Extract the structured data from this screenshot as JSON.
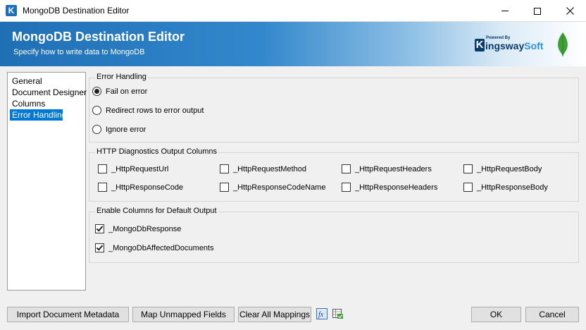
{
  "window": {
    "title": "MongoDB Destination Editor"
  },
  "banner": {
    "title": "MongoDB Destination Editor",
    "subtitle": "Specify how to write data to MongoDB",
    "logo_powered": "Powered By",
    "logo_letter": "K",
    "logo_name_a": "ingsway",
    "logo_name_b": "Soft"
  },
  "nav": {
    "items": [
      {
        "label": "General"
      },
      {
        "label": "Document Designer"
      },
      {
        "label": "Columns"
      },
      {
        "label": "Error Handling"
      }
    ],
    "selected": "Error Handling"
  },
  "error_handling": {
    "group_label": "Error Handling",
    "options": [
      {
        "label": "Fail on error",
        "selected": true
      },
      {
        "label": "Redirect rows to error output",
        "selected": false
      },
      {
        "label": "Ignore error",
        "selected": false
      }
    ]
  },
  "http_diagnostics": {
    "group_label": "HTTP Diagnostics Output Columns",
    "columns": [
      {
        "label": "_HttpRequestUrl",
        "checked": false
      },
      {
        "label": "_HttpRequestMethod",
        "checked": false
      },
      {
        "label": "_HttpRequestHeaders",
        "checked": false
      },
      {
        "label": "_HttpRequestBody",
        "checked": false
      },
      {
        "label": "_HttpResponseCode",
        "checked": false
      },
      {
        "label": "_HttpResponseCodeName",
        "checked": false
      },
      {
        "label": "_HttpResponseHeaders",
        "checked": false
      },
      {
        "label": "_HttpResponseBody",
        "checked": false
      }
    ]
  },
  "default_output": {
    "group_label": "Enable Columns for Default Output",
    "columns": [
      {
        "label": "_MongoDbResponse",
        "checked": true
      },
      {
        "label": "_MongoDbAffectedDocuments",
        "checked": true
      }
    ]
  },
  "buttons": {
    "import_metadata": "Import Document Metadata",
    "map_unmapped": "Map Unmapped Fields",
    "clear_mappings": "Clear All Mappings",
    "ok": "OK",
    "cancel": "Cancel"
  },
  "colors": {
    "banner_start": "#1f6fb5",
    "selection": "#0078d7",
    "logo_dark": "#0a3a6b",
    "logo_light": "#2c92d6",
    "leaf": "#3fa037"
  },
  "icons": {
    "window": "kingswaysoft-k-icon",
    "fx": "fx-expression-icon",
    "grid": "grid-check-icon",
    "banner_right": "mongodb-leaf-icon"
  }
}
